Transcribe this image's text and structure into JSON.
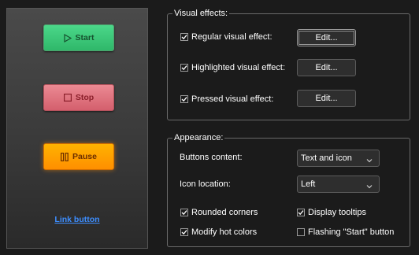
{
  "preview": {
    "start_label": "Start",
    "stop_label": "Stop",
    "pause_label": "Pause",
    "link_label": "Link button"
  },
  "visual_effects": {
    "title": "Visual effects:",
    "rows": [
      {
        "label": "Regular visual effect:",
        "checked": true,
        "button": "Edit..."
      },
      {
        "label": "Highlighted visual effect:",
        "checked": true,
        "button": "Edit..."
      },
      {
        "label": "Pressed visual effect:",
        "checked": true,
        "button": "Edit..."
      }
    ]
  },
  "appearance": {
    "title": "Appearance:",
    "buttons_content_label": "Buttons content:",
    "buttons_content_value": "Text and icon",
    "icon_location_label": "Icon location:",
    "icon_location_value": "Left",
    "options": [
      {
        "label": "Rounded corners",
        "checked": true
      },
      {
        "label": "Display tooltips",
        "checked": true
      },
      {
        "label": "Modify hot colors",
        "checked": true
      },
      {
        "label": "Flashing \"Start\" button",
        "checked": false
      }
    ]
  },
  "colors": {
    "start": "#3cc97a",
    "stop": "#e07480",
    "pause": "#ffa000",
    "link": "#3d8eff"
  }
}
